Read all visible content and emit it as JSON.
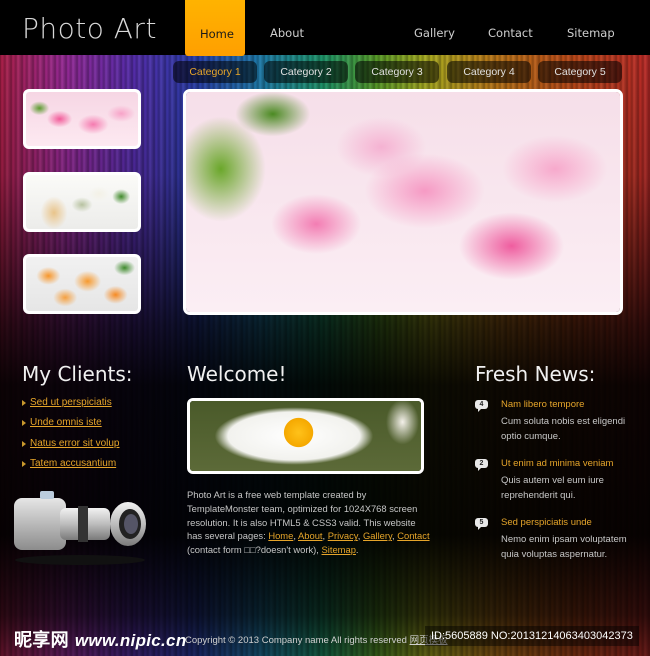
{
  "header": {
    "logo": "Photo Art",
    "nav": [
      {
        "label": "Home",
        "active": true
      },
      {
        "label": "About"
      },
      {
        "label": "Gallery"
      },
      {
        "label": "Contact"
      },
      {
        "label": "Sitemap"
      }
    ],
    "accent_color": "#ffb000"
  },
  "categories": [
    {
      "label": "Category 1",
      "active": true
    },
    {
      "label": "Category 2"
    },
    {
      "label": "Category 3"
    },
    {
      "label": "Category 4"
    },
    {
      "label": "Category 5"
    }
  ],
  "gallery": {
    "thumbnails": [
      "pink peonies",
      "spa diffuser with flowers",
      "orange roses"
    ],
    "hero": "pink fringed tulips"
  },
  "clients": {
    "title": "My Clients:",
    "items": [
      "Sed ut perspiciatis",
      "Unde omnis iste",
      "Natus error sit volup",
      "Tatem accusantium"
    ]
  },
  "welcome": {
    "title": "Welcome!",
    "image": "white daisy",
    "text_1": "Photo Art is a free web template created by TemplateMonster team, optimized for 1024X768 screen resolution. It is also HTML5 & CSS3 valid. This website has several pages: ",
    "links": [
      "Home",
      "About",
      "Privacy",
      "Gallery",
      "Contact",
      "Sitemap"
    ],
    "text_contact_note": " (contact form □□?doesn't work), ",
    "sep": ", ",
    "end": "."
  },
  "news": {
    "title": "Fresh News:",
    "items": [
      {
        "badge": "4",
        "title": "Nam libero tempore",
        "body": "Cum soluta nobis est eligendi optio cumque."
      },
      {
        "badge": "2",
        "title": "Ut enim ad minima veniam",
        "body": "Quis autem vel eum iure reprehenderit qui."
      },
      {
        "badge": "5",
        "title": "Sed perspiciatis unde",
        "body": "Nemo enim ipsam voluptatem quia voluptas aspernatur."
      }
    ]
  },
  "footer": {
    "copyright": "Copyright © 2013 Company name All rights reserved ",
    "link": "网页模板"
  },
  "watermark": {
    "site_cn": "昵享网",
    "site_url": "www.nipic.cn",
    "id_text": "ID:5605889 NO:20131214063403042373"
  }
}
